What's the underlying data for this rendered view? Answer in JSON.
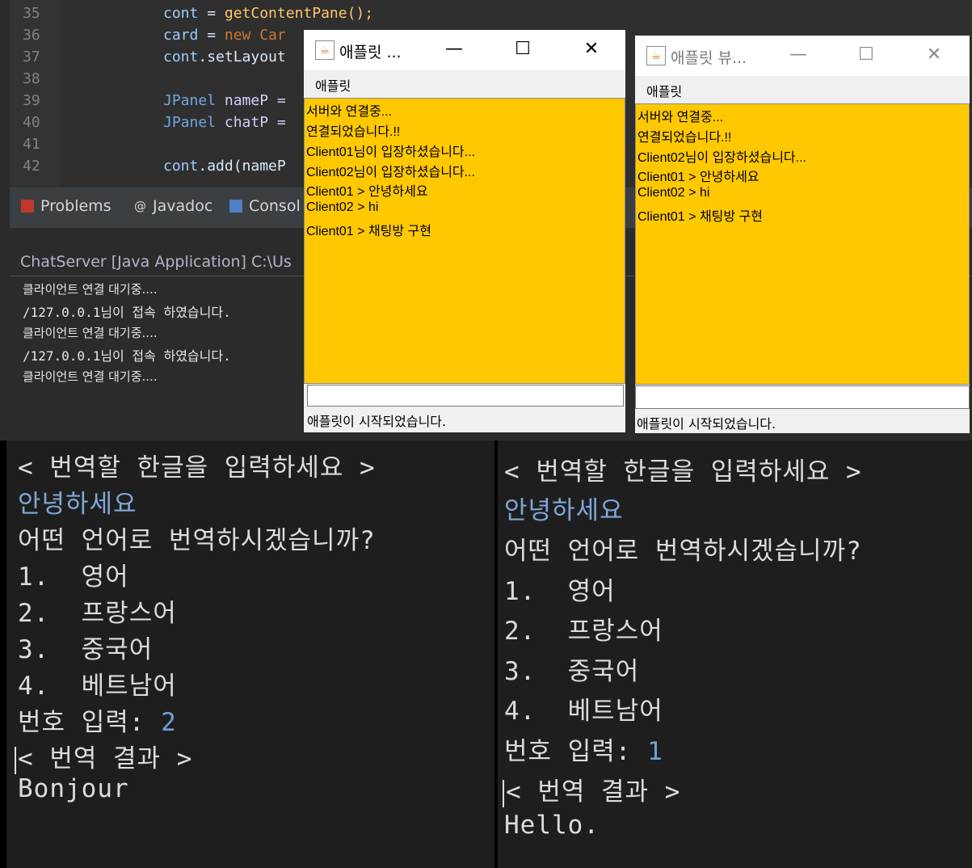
{
  "editor": {
    "lines": [
      {
        "no": "35",
        "text_a": "cont",
        "text_b": " = ",
        "text_c": "getContentPane();"
      },
      {
        "no": "36",
        "text_a": "card",
        "text_b": " = ",
        "text_c": "new Car"
      },
      {
        "no": "37",
        "text_a": "cont",
        "text_b": ".setLayout",
        "": ""
      },
      {
        "no": "38"
      },
      {
        "no": "39",
        "text_a": "JPanel",
        "text_b": " nameP ="
      },
      {
        "no": "40",
        "text_a": "JPanel",
        "text_b": " chatP ="
      },
      {
        "no": "41"
      },
      {
        "no": "42",
        "text_a": "cont",
        "text_b": ".add(nameP"
      }
    ]
  },
  "views": {
    "problems": "Problems",
    "javadoc": "Javadoc",
    "console": "Consol"
  },
  "console": {
    "title": "ChatServer [Java Application] C:\\Us",
    "lines": [
      "클라이언트 연결 대기중....",
      "/127.0.0.1님이 접속 하였습니다.",
      "클라이언트 연결 대기중....",
      "/127.0.0.1님이 접속 하였습니다.",
      "클라이언트 연결 대기중...."
    ]
  },
  "applet1": {
    "title": "애플릿 ...",
    "menu": "애플릿",
    "messages": [
      "서버와 연결중...",
      "연결되었습니다.!!",
      "Client01님이 입장하셨습니다...",
      "Client02님이 입장하셨습니다...",
      "Client01 >  안녕하세요",
      "Client02 > hi",
      "Client01 > 채팅방 구현"
    ],
    "input_value": "",
    "status": "애플릿이 시작되었습니다."
  },
  "applet2": {
    "title": "애플릿 뷰...",
    "menu": "애플릿",
    "messages": [
      "서버와 연결중...",
      " 연결되었습니다.!!",
      "Client02님이 입장하셨습니다...",
      "Client01 >  안녕하세요",
      "Client02 > hi",
      "Client01 > 채팅방 구현"
    ],
    "input_value": "",
    "status": "애플릿이 시작되었습니다."
  },
  "window_buttons": {
    "minimize": "—",
    "maximize": "☐",
    "close": "✕"
  },
  "translate_left": {
    "prompt": "< 번역할 한글을 입력하세요 >",
    "input": "안녕하세요",
    "question": "어떤 언어로 번역하시겠습니까?",
    "options": [
      "1.  영어",
      "2.  프랑스어",
      "3.  중국어",
      "4.  베트남어"
    ],
    "number_label": "번호 입력: ",
    "number_value": "2",
    "result_label": "< 번역 결과 >",
    "result": "Bonjour"
  },
  "translate_right": {
    "prompt": "< 번역할 한글을 입력하세요 >",
    "input": "안녕하세요",
    "question": "어떤 언어로 번역하시겠습니까?",
    "options": [
      "1.  영어",
      "2.  프랑스어",
      "3.  중국어",
      "4.  베트남어"
    ],
    "number_label": "번호 입력: ",
    "number_value": "1",
    "result_label": "< 번역 결과 >",
    "result": "Hello."
  }
}
